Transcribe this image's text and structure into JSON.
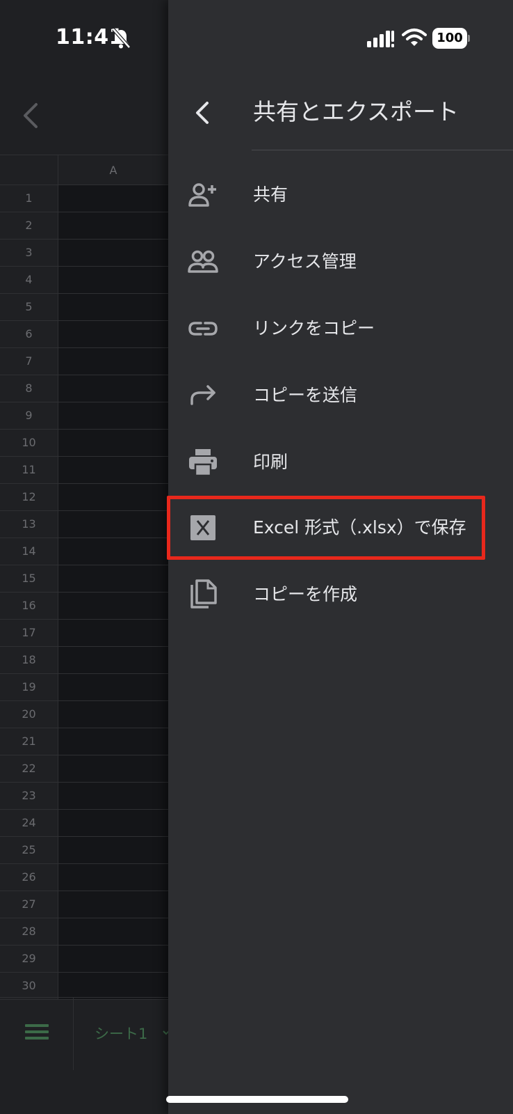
{
  "status_bar": {
    "time": "11:41",
    "battery_level": "100",
    "icons": [
      "bell-off-icon",
      "signal-icon",
      "wifi-icon",
      "battery-icon"
    ]
  },
  "sheet": {
    "column_header": "A",
    "row_numbers": [
      "1",
      "2",
      "3",
      "4",
      "5",
      "6",
      "7",
      "8",
      "9",
      "10",
      "11",
      "12",
      "13",
      "14",
      "15",
      "16",
      "17",
      "18",
      "19",
      "20",
      "21",
      "22",
      "23",
      "24",
      "25",
      "26",
      "27",
      "28",
      "29",
      "30"
    ],
    "sheet_tab_label": "シート1",
    "accent_color": "#3c6a48"
  },
  "drawer": {
    "title": "共有とエクスポート",
    "items": [
      {
        "label": "共有",
        "icon": "person-add-icon"
      },
      {
        "label": "アクセス管理",
        "icon": "people-icon"
      },
      {
        "label": "リンクをコピー",
        "icon": "link-icon"
      },
      {
        "label": "コピーを送信",
        "icon": "forward-arrow-icon"
      },
      {
        "label": "印刷",
        "icon": "printer-icon"
      },
      {
        "label": "Excel 形式（.xlsx）で保存",
        "icon": "excel-file-icon"
      },
      {
        "label": "コピーを作成",
        "icon": "copy-icon"
      }
    ],
    "highlighted_item": "Excel 形式（.xlsx）で保存",
    "highlight_color": "#e8281c"
  }
}
